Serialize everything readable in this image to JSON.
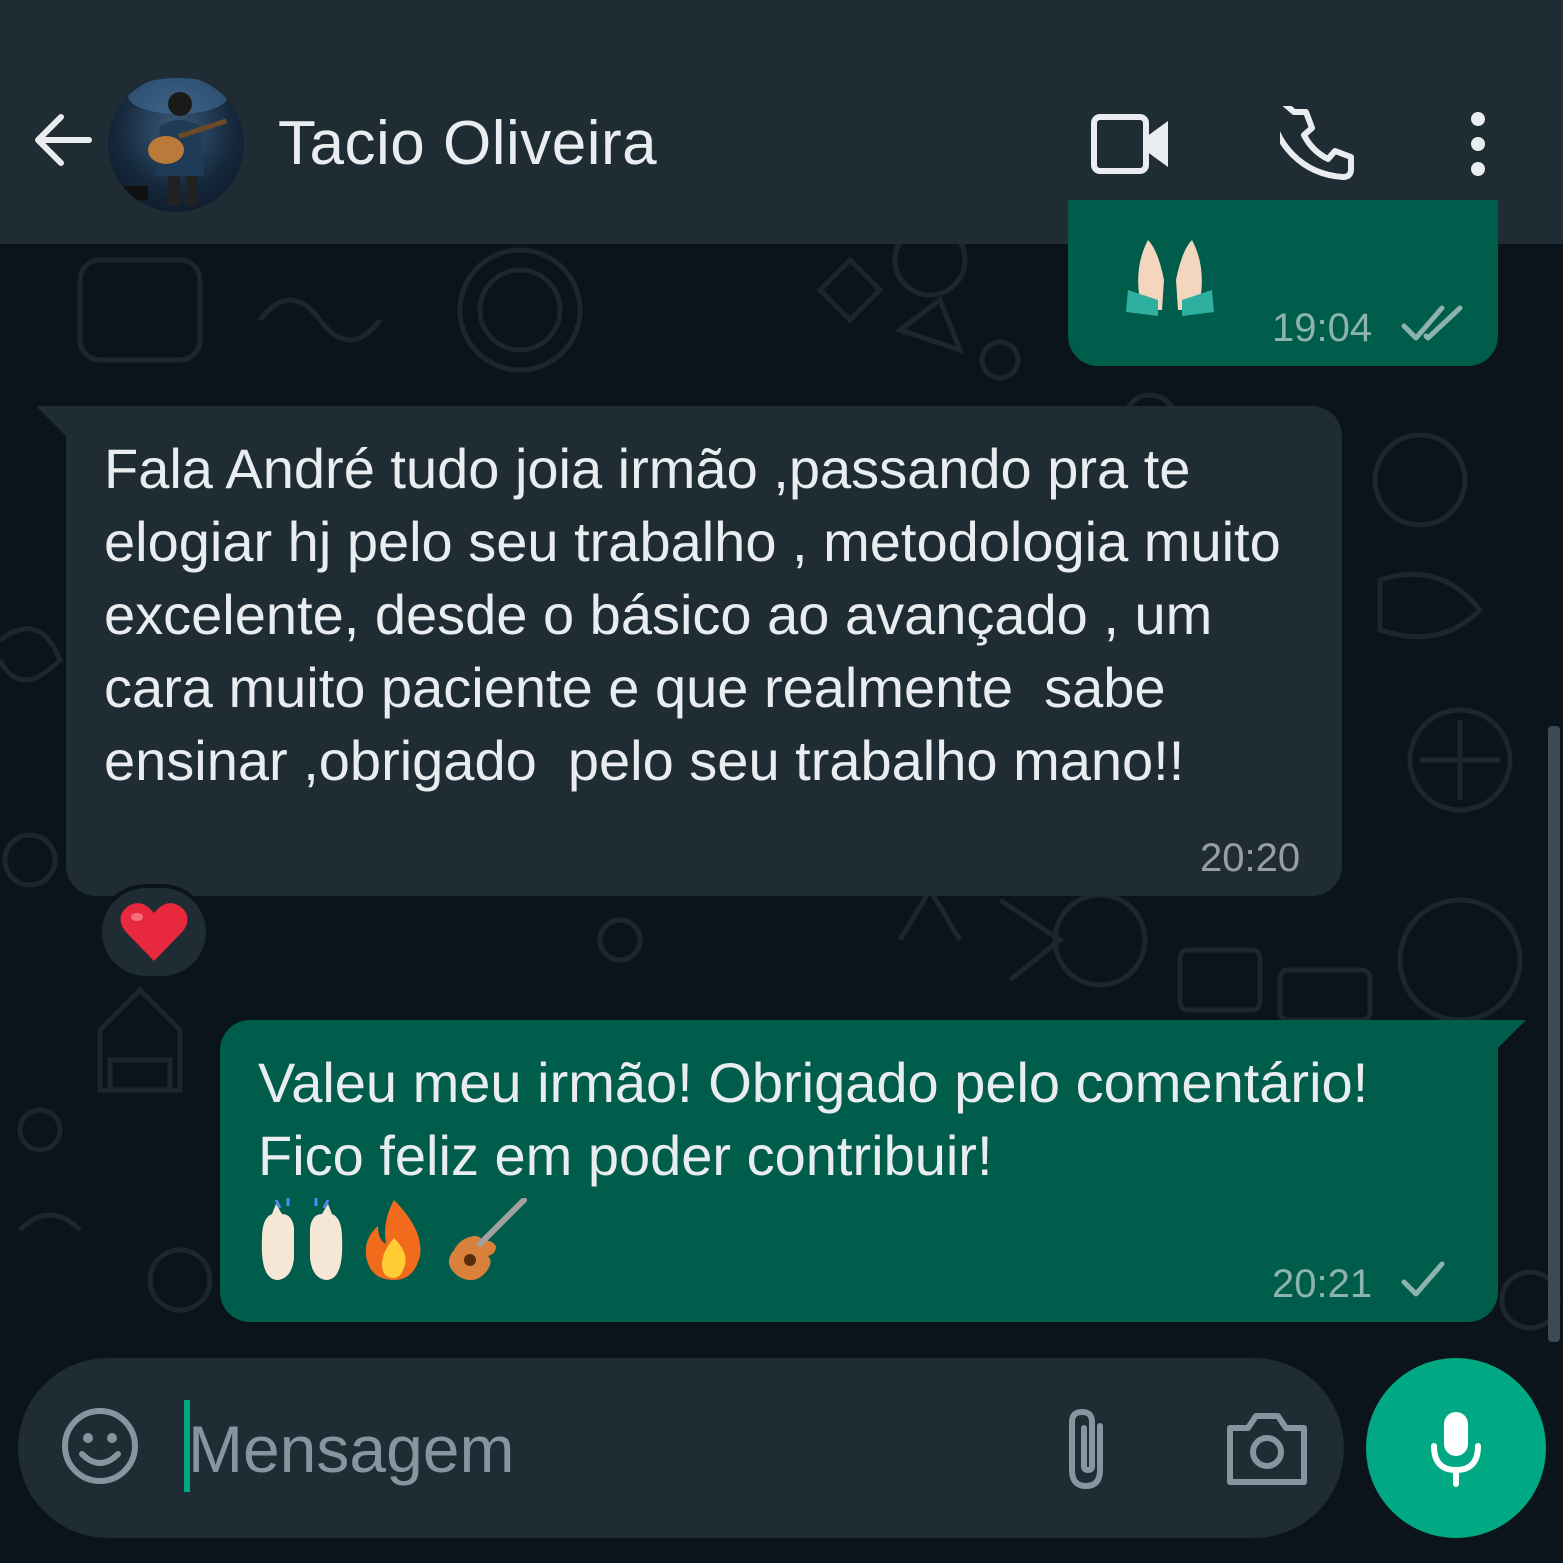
{
  "contact": {
    "name": "Tacio Oliveira",
    "avatar": "avatar-photo-guitarist"
  },
  "header": {
    "icons": [
      "back-arrow-icon",
      "video-call-icon",
      "voice-call-icon",
      "more-options-icon"
    ]
  },
  "messages": [
    {
      "direction": "outgoing",
      "emoji": "🙏🏻",
      "time": "19:04",
      "status": "read-double-check"
    },
    {
      "direction": "incoming",
      "text": "Fala André tudo joia irmão ,passando pra te elogiar hj pelo seu trabalho , metodologia muito excelente, desde o básico ao avançado , um cara muito paciente e que realmente  sabe ensinar ,obrigado  pelo seu trabalho mano!!",
      "time": "20:20",
      "reaction": "❤️"
    },
    {
      "direction": "outgoing",
      "text": "Valeu meu irmão! Obrigado pelo comentário! Fico feliz em poder contribuir!",
      "emojis": "🙌🏻🔥🎸",
      "time": "20:21",
      "status": "sent-single-check"
    }
  ],
  "composer": {
    "placeholder": "Mensagem",
    "icons": [
      "emoji-icon",
      "attach-icon",
      "camera-icon",
      "microphone-icon"
    ]
  },
  "colors": {
    "background": "#0b141a",
    "header": "#1f2c34",
    "outgoing_bubble": "#005c4b",
    "incoming_bubble": "#1f2c34",
    "accent": "#00a884"
  }
}
